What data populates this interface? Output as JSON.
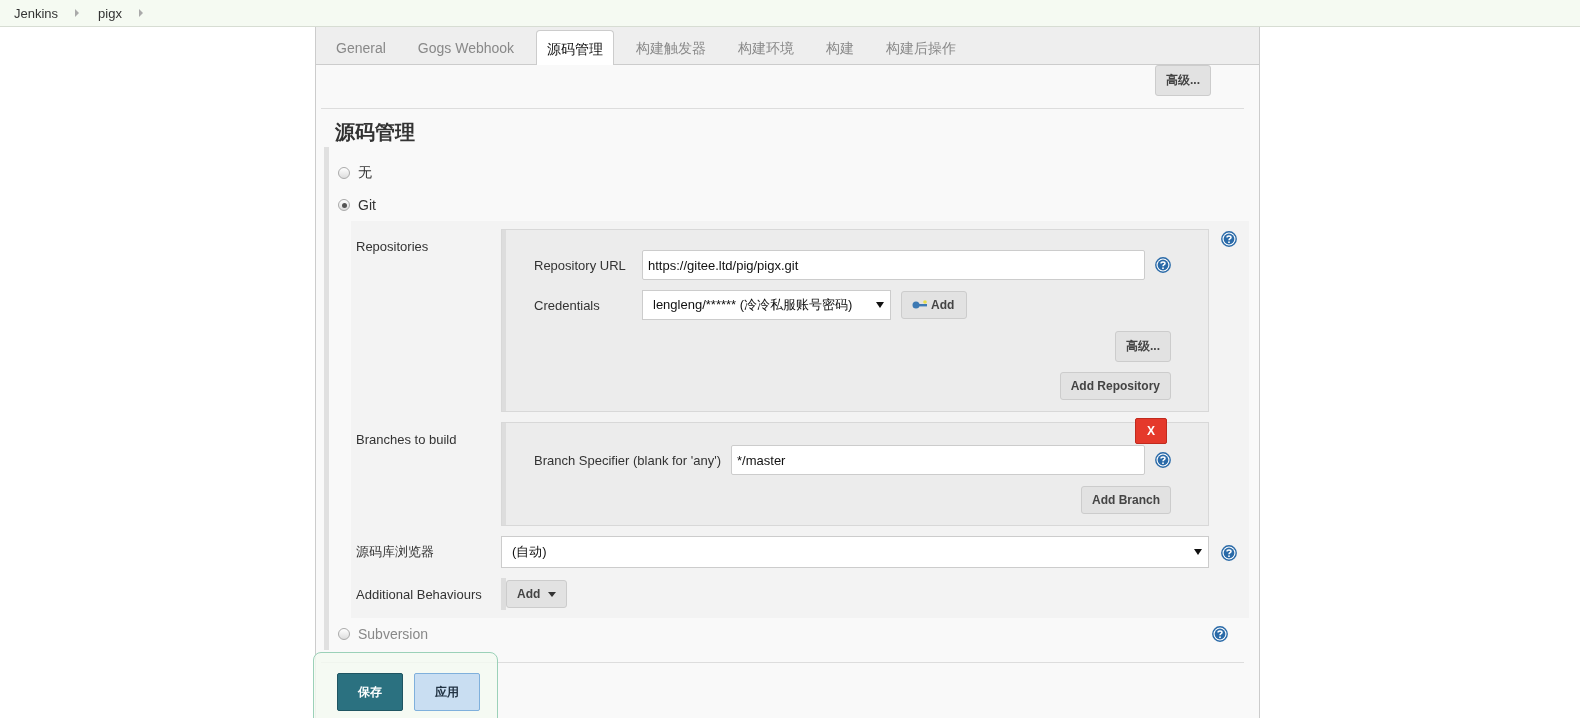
{
  "breadcrumbs": [
    {
      "label": "Jenkins"
    },
    {
      "label": "pigx"
    }
  ],
  "tabs": [
    {
      "label": "General",
      "selected": false
    },
    {
      "label": "Gogs Webhook",
      "selected": false
    },
    {
      "label": "源码管理",
      "selected": true
    },
    {
      "label": "构建触发器",
      "selected": false
    },
    {
      "label": "构建环境",
      "selected": false
    },
    {
      "label": "构建",
      "selected": false
    },
    {
      "label": "构建后操作",
      "selected": false
    }
  ],
  "top_advanced_button": "高级...",
  "section": {
    "title": "源码管理",
    "options": [
      {
        "label": "无",
        "selected": false
      },
      {
        "label": "Git",
        "selected": true
      },
      {
        "label": "Subversion",
        "selected": false
      }
    ],
    "git": {
      "repositories_label": "Repositories",
      "repository_url_label": "Repository URL",
      "repository_url": "https://gitee.ltd/pig/pigx.git",
      "credentials_label": "Credentials",
      "credentials_value": "lengleng/****** (冷冷私服账号密码)",
      "credentials_add_button": "Add",
      "advanced_button": "高级...",
      "add_repository_button": "Add Repository",
      "branches_label": "Branches to build",
      "branch_specifier_label": "Branch Specifier (blank for 'any')",
      "branch_specifier": "*/master",
      "delete_button": "X",
      "add_branch_button": "Add Branch",
      "browser_label": "源码库浏览器",
      "browser_value": "(自动)",
      "behaviours_label": "Additional Behaviours",
      "behaviours_add_button": "Add"
    }
  },
  "footer_buttons": [
    {
      "label": "保存",
      "kind": "primary"
    },
    {
      "label": "应用",
      "kind": "secondary"
    }
  ]
}
